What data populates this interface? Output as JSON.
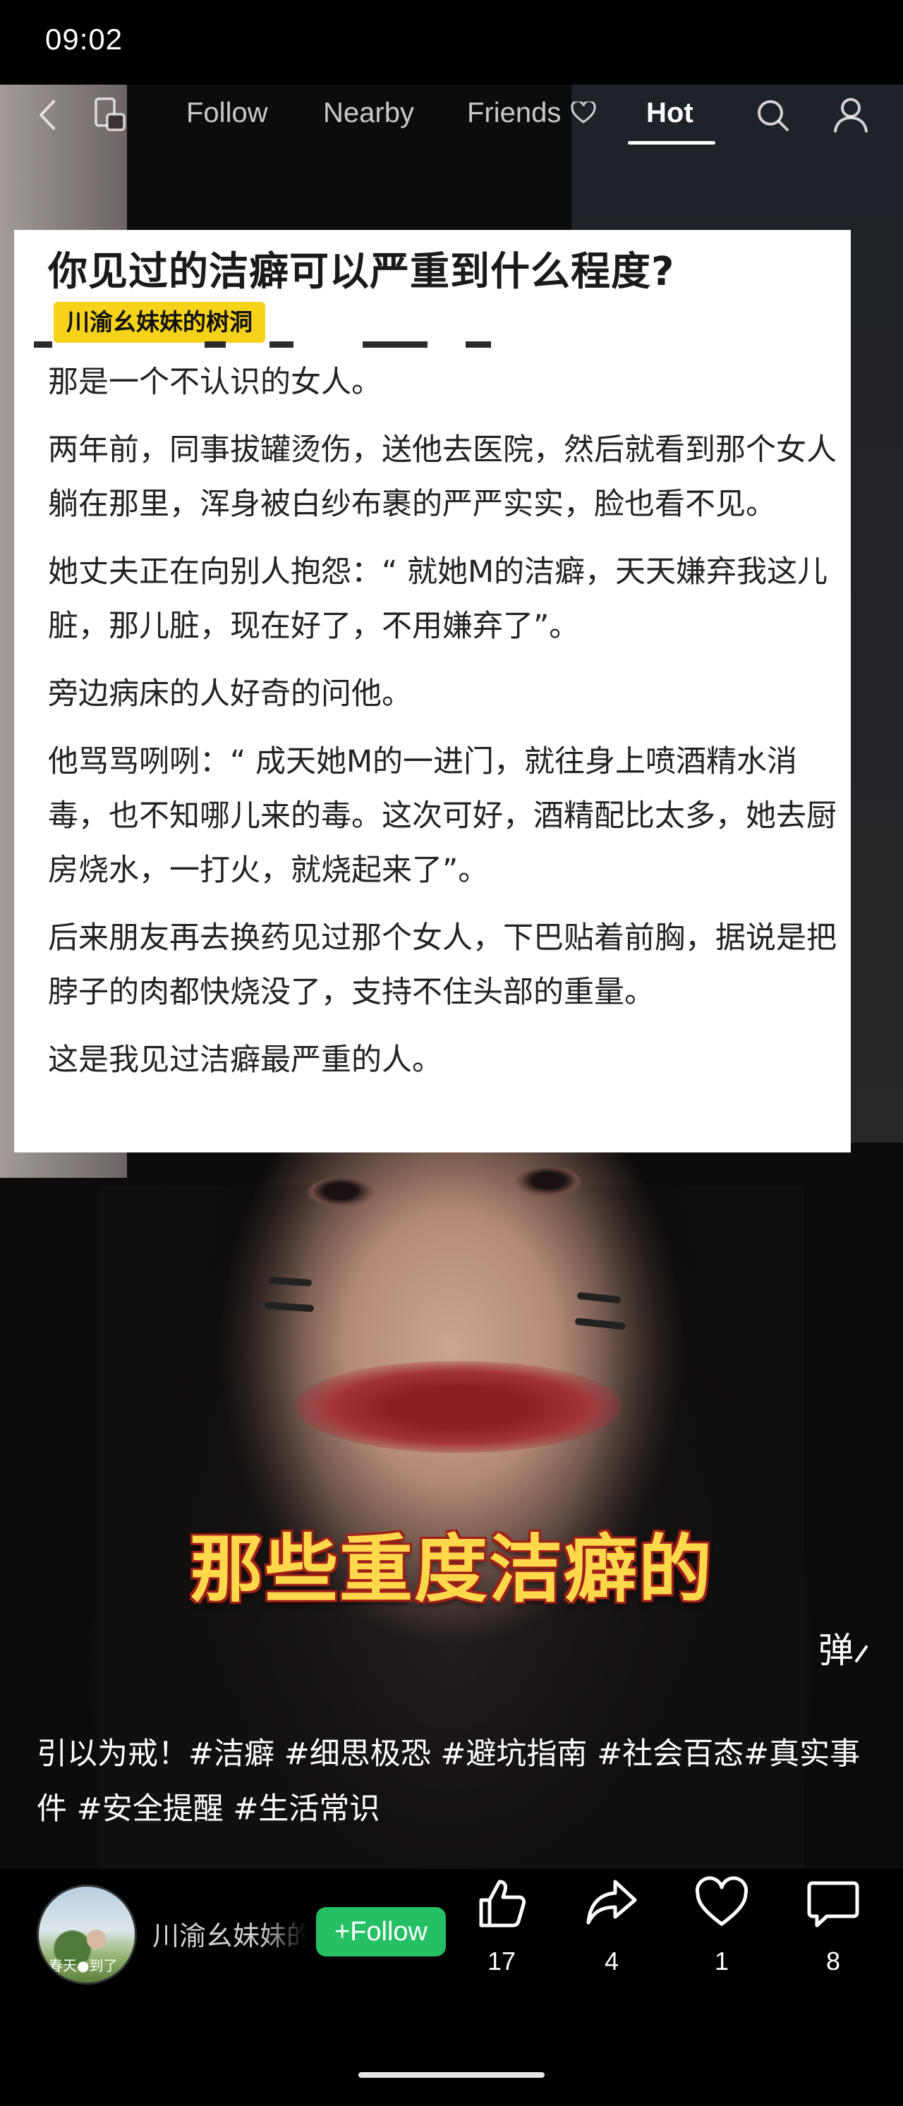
{
  "status_bar": {
    "time": "09:02"
  },
  "nav": {
    "tabs": [
      {
        "label": "Follow"
      },
      {
        "label": "Nearby"
      },
      {
        "label": "Friends"
      },
      {
        "label": "Hot"
      }
    ],
    "active_tab": "Hot",
    "icons": [
      "back-arrow-icon",
      "multi-window-icon",
      "heart-outline-icon",
      "search-icon",
      "profile-icon"
    ]
  },
  "article": {
    "title": "你见过的洁癖可以严重到什么程度?",
    "author_tag": "川渝幺妹妹的树洞",
    "paragraphs": [
      "那是一个不认识的女人。",
      "两年前，同事拔罐烫伤，送他去医院，然后就看到那个女人躺在那里，浑身被白纱布裹的严严实实，脸也看不见。",
      "她丈夫正在向别人抱怨：“ 就她M的洁癖，天天嫌弃我这儿脏，那儿脏，现在好了，不用嫌弃了”。",
      "旁边病床的人好奇的问他。",
      "他骂骂咧咧：“ 成天她M的一进门，就往身上喷酒精水消毒，也不知哪儿来的毒。这次可好，酒精配比太多，她去厨房烧水，一打火，就烧起来了”。",
      "后来朋友再去换药见过那个女人，下巴贴着前胸，据说是把脖子的肉都快烧没了，支持不住头部的重量。",
      "这是我见过洁癖最严重的人。"
    ]
  },
  "video": {
    "subtitle": "那些重度洁癖的",
    "danmaku_label": "弹"
  },
  "caption": "引以为戒！#洁癖 #细思极恐 #避坑指南 #社会百态#真实事件 #安全提醒 #生活常识",
  "bottom": {
    "avatar_text": "春天●到了",
    "username": "川渝幺妹妹的树洞",
    "follow_label": "+Follow",
    "actions": [
      {
        "icon": "thumbs-up-icon",
        "count": "17"
      },
      {
        "icon": "share-icon",
        "count": "4"
      },
      {
        "icon": "heart-icon",
        "count": "1"
      },
      {
        "icon": "comment-icon",
        "count": "8"
      }
    ]
  },
  "colors": {
    "follow_green": "#26c064",
    "tag_yellow": "#f6d21a",
    "subtitle_yellow": "#ffd94a",
    "subtitle_outline": "#a0201a"
  }
}
